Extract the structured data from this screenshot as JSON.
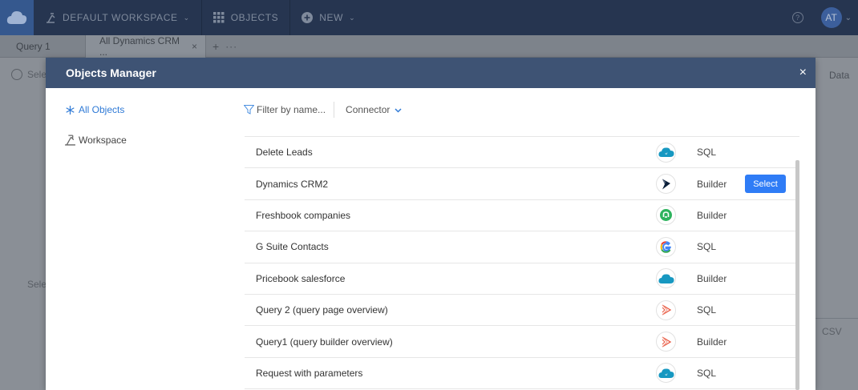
{
  "topbar": {
    "workspace_label": "DEFAULT WORKSPACE",
    "objects_label": "OBJECTS",
    "new_label": "NEW",
    "help_glyph": "?",
    "avatar_initials": "AT"
  },
  "tabs": [
    {
      "label": "Query 1"
    },
    {
      "label": "All Dynamics CRM ..."
    }
  ],
  "background": {
    "select_label_1": "Sele",
    "select_label_2": "Selec",
    "data_label": "Data",
    "csv_label": "CSV"
  },
  "modal": {
    "title": "Objects Manager",
    "close_glyph": "×",
    "sidebar": {
      "all_objects": "All Objects",
      "workspace": "Workspace"
    },
    "filter": {
      "placeholder": "Filter by name...",
      "connector_label": "Connector"
    },
    "select_button": "Select",
    "rows": [
      {
        "name": "Delete Leads",
        "connector_icon": "salesforce-icon",
        "type": "SQL"
      },
      {
        "name": "Dynamics CRM2",
        "connector_icon": "dynamics-icon",
        "type": "Builder"
      },
      {
        "name": "Freshbook companies",
        "connector_icon": "freshbooks-icon",
        "type": "Builder"
      },
      {
        "name": "G Suite Contacts",
        "connector_icon": "google-icon",
        "type": "SQL"
      },
      {
        "name": "Pricebook salesforce",
        "connector_icon": "salesforce-icon",
        "type": "Builder"
      },
      {
        "name": "Query 2 (query page overview)",
        "connector_icon": "skyvia-query-icon",
        "type": "SQL"
      },
      {
        "name": "Query1 (query builder overview)",
        "connector_icon": "skyvia-query-icon",
        "type": "Builder"
      },
      {
        "name": "Request with parameters",
        "connector_icon": "salesforce-icon",
        "type": "SQL"
      }
    ]
  },
  "colors": {
    "accent": "#2f7cf6",
    "header": "#3e5374",
    "topbar": "#263550"
  }
}
